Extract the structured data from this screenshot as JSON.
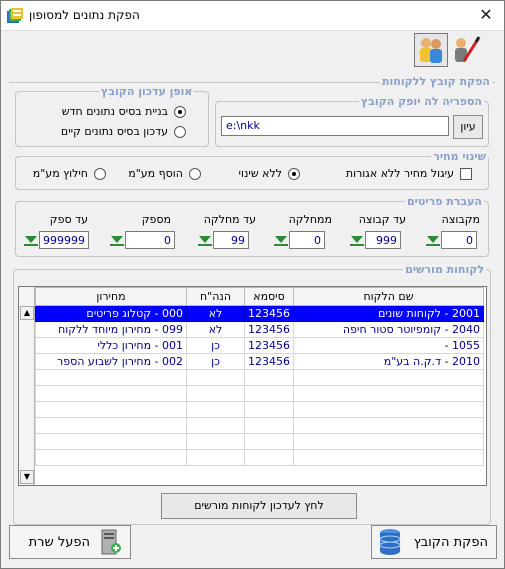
{
  "window": {
    "title": "הפקת נתונים למסופון",
    "close_icon": "close-icon"
  },
  "export_section": {
    "legend": "הפקת קובץ ללקוחות",
    "folder": {
      "legend": "הספריה לה יופק הקובץ",
      "value": "e:\\nkk",
      "browse_label": "עיון"
    },
    "update_mode": {
      "legend": "אופן עדכון הקובץ",
      "options": [
        {
          "label": "בניית בסיס נתונים חדש",
          "checked": true
        },
        {
          "label": "עדכון בסיס נתונים קיים",
          "checked": false
        }
      ]
    }
  },
  "price_change": {
    "legend": "שינוי מחיר",
    "round_label": "עיגול מחיר ללא אגורות",
    "options": [
      {
        "label": "ללא שינוי",
        "checked": true
      },
      {
        "label": "הוסף מע\"מ",
        "checked": false
      },
      {
        "label": "חילוץ מע\"מ",
        "checked": false
      }
    ]
  },
  "items_transfer": {
    "legend": "העברת פריטים",
    "fields": [
      {
        "label": "מקבוצה",
        "value": "0"
      },
      {
        "label": "עד קבוצה",
        "value": "999"
      },
      {
        "label": "ממחלקה",
        "value": "0"
      },
      {
        "label": "עד מחלקה",
        "value": "99"
      },
      {
        "label": "מספק",
        "value": "0"
      },
      {
        "label": "עד ספק",
        "value": "999999"
      }
    ]
  },
  "authorized_customers": {
    "legend": "לקוחות מורשים",
    "columns": [
      "שם הלקוח",
      "סיסמא",
      "הנה\"ח",
      "מחירון"
    ],
    "rows": [
      {
        "name": "2001 - לקוחות שונים",
        "password": "123456",
        "accounting": "לא",
        "price_list": "000 - קטלוג פריטים",
        "selected": true
      },
      {
        "name": "2040 - קומפיוטר סטור חיפה",
        "password": "123456",
        "accounting": "לא",
        "price_list": "099 - מחירון מיוחד ללקוח",
        "selected": false
      },
      {
        "name": "1055 -",
        "password": "123456",
        "accounting": "כן",
        "price_list": "001 - מחירון כללי",
        "selected": false
      },
      {
        "name": "2010 - ד.ק.ה בע\"מ",
        "password": "123456",
        "accounting": "כן",
        "price_list": "002 - מחירון לשבוע הספר",
        "selected": false
      }
    ],
    "update_button_label": "לחץ לעדכון לקוחות מורשים"
  },
  "footer": {
    "export_button_label": "הפקת הקובץ",
    "run_server_button_label": "הפעל שרת"
  },
  "colors": {
    "selection": "#0000ff",
    "legend": "#8aa0c8",
    "value_text": "#00008b",
    "spin_arrow": "#2e8b3a"
  }
}
